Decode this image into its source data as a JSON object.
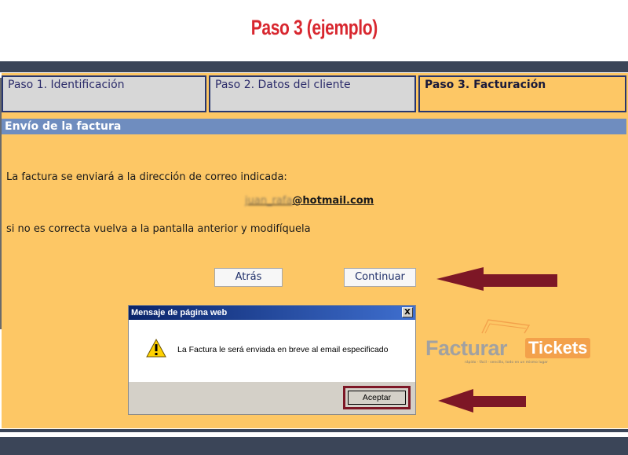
{
  "heading": "Paso 3 (ejemplo)",
  "tabs": [
    {
      "label": "Paso 1. Identificación",
      "active": false
    },
    {
      "label": "Paso 2. Datos del cliente",
      "active": false
    },
    {
      "label": "Paso 3. Facturación",
      "active": true
    }
  ],
  "section_title": "Envío de la factura",
  "body": {
    "line1": "La factura se enviará a la dirección de correo indicada:",
    "email_obscured": "juan_rafa",
    "email_domain": "@hotmail.com",
    "line2": "si no es correcta vuelva a la pantalla anterior y modifíquela"
  },
  "buttons": {
    "back": "Atrás",
    "continue": "Continuar"
  },
  "dialog": {
    "title": "Mensaje de página web",
    "close": "X",
    "message": "La Factura le será enviada en breve al email especificado",
    "ok": "Aceptar"
  },
  "logo": {
    "word1": "Facturar",
    "word2": "Tickets",
    "tagline": "rápido · fácil · sencillo, todo en un mismo lugar"
  },
  "colors": {
    "heading": "#d8272f",
    "panel": "#fdc765",
    "section_bar": "#6f8dbf",
    "band": "#3b4558",
    "arrow": "#7d1726",
    "logo_accent": "#f3a14b"
  }
}
